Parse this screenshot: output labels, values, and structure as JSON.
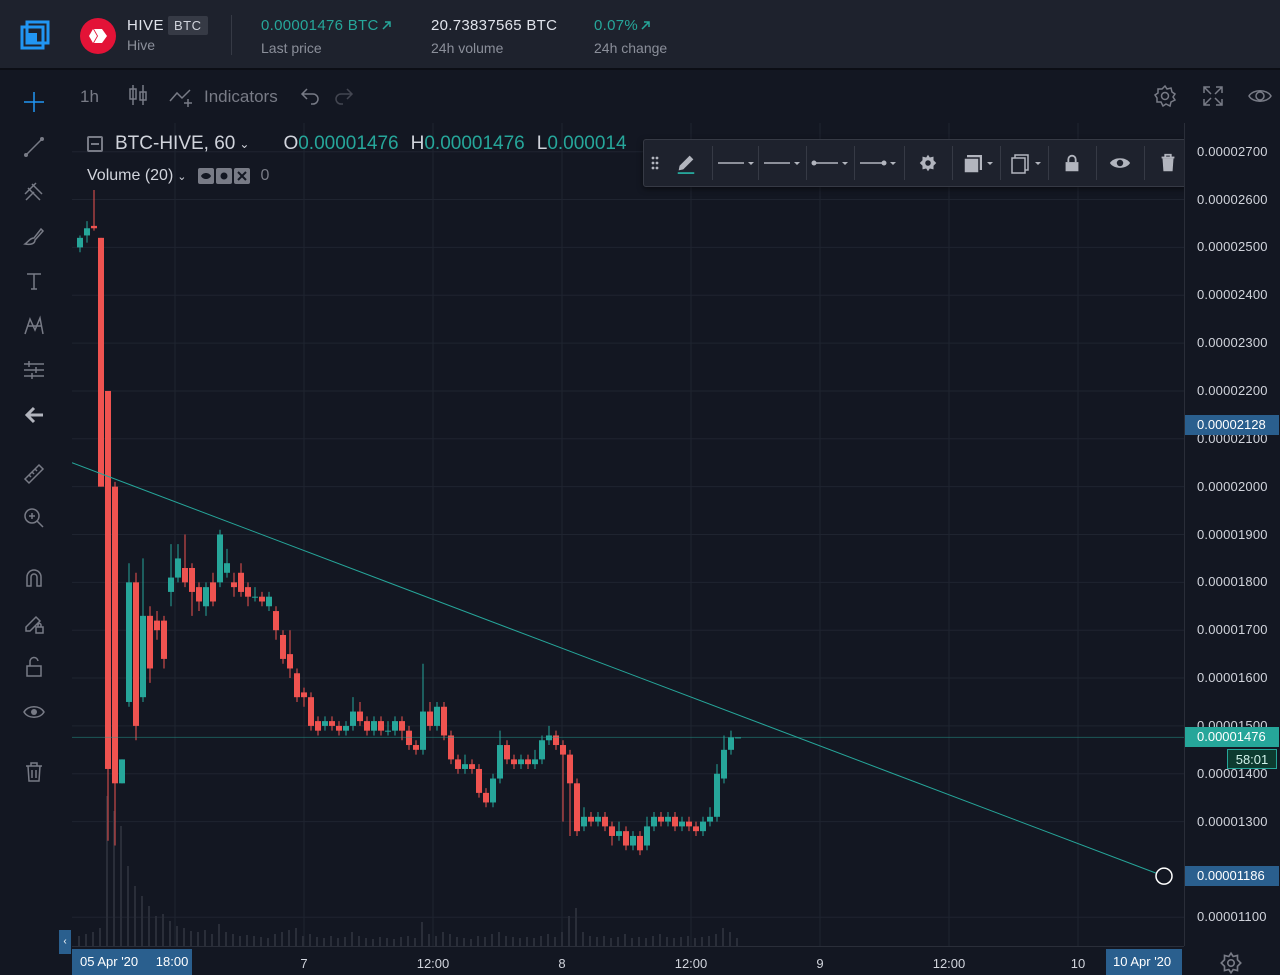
{
  "market": {
    "base": "HIVE",
    "quote": "BTC",
    "name": "Hive",
    "last_price": "0.00001476 BTC",
    "last_price_label": "Last price",
    "volume": "20.73837565 BTC",
    "volume_label": "24h volume",
    "change": "0.07%",
    "change_label": "24h change"
  },
  "toolbar": {
    "interval": "1h",
    "indicators_label": "Indicators"
  },
  "legend": {
    "symbol": "BTC-HIVE, 60",
    "open_key": "O",
    "open": "0.00001476",
    "high_key": "H",
    "high": "0.00001476",
    "low_key": "L",
    "low": "0.000014"
  },
  "volume_study": {
    "label": "Volume (20)",
    "value": "0"
  },
  "price_axis": {
    "ticks": [
      "0.00002700",
      "0.00002600",
      "0.00002500",
      "0.00002400",
      "0.00002300",
      "0.00002200",
      "0.00002100",
      "0.00002000",
      "0.00001900",
      "0.00001800",
      "0.00001700",
      "0.00001600",
      "0.00001500",
      "0.00001400",
      "0.00001300",
      "0.00001100"
    ],
    "marker_top": "0.00002128",
    "marker_current": "0.00001476",
    "countdown": "58:01",
    "marker_bottom": "0.00001186"
  },
  "time_axis": {
    "range_start": "05 Apr '20",
    "range_start_time": "18:00",
    "range_end": "10 Apr '20",
    "labels": [
      "7",
      "12:00",
      "8",
      "12:00",
      "9",
      "12:00",
      "10"
    ]
  },
  "colors": {
    "background": "#131722",
    "panel": "#1e222d",
    "up": "#26a69a",
    "down": "#ef5350",
    "trendline": "#26a69a",
    "accent_blue": "#2a5f8e",
    "hive_red": "#e31337"
  },
  "icons": {
    "left_toolbar": [
      "crosshair-icon",
      "trend-line-icon",
      "pitchfork-icon",
      "brush-icon",
      "text-icon",
      "pattern-icon",
      "forecast-icon",
      "back-arrow-icon",
      "ruler-icon",
      "zoom-in-icon",
      "magnet-icon",
      "lock-drawing-icon",
      "unlock-icon",
      "eye-icon",
      "trash-icon"
    ],
    "floating_toolbar": [
      "drag-handle-icon",
      "pencil-icon",
      "line-color-icon",
      "line-width-icon",
      "line-start-icon",
      "line-end-icon",
      "gear-icon",
      "fill-icon",
      "clone-icon",
      "lock-icon",
      "eye-icon",
      "trash-icon"
    ]
  },
  "chart_data": {
    "type": "candlestick",
    "interval": "60m",
    "ylim": [
      1.04e-05,
      2.76e-05
    ],
    "x_labels": [
      "7",
      "12:00",
      "8",
      "12:00",
      "9",
      "12:00",
      "10"
    ],
    "candles_ohlc": [
      [
        2.5e-05,
        2.52e-05,
        2.49e-05,
        2.525e-05
      ],
      [
        2.525e-05,
        2.54e-05,
        2.51e-05,
        2.555e-05
      ],
      [
        2.545e-05,
        2.54e-05,
        2.62e-05,
        2.535e-05
      ],
      [
        2.52e-05,
        2e-05,
        2.52e-05,
        2e-05
      ],
      [
        2.2e-05,
        1.41e-05,
        2.2e-05,
        1.26e-05
      ],
      [
        2e-05,
        1.38e-05,
        2.01e-05,
        1.25e-05
      ],
      [
        1.38e-05,
        1.43e-05,
        1.38e-05,
        1.42e-05
      ],
      [
        1.55e-05,
        1.8e-05,
        1.54e-05,
        1.84e-05
      ],
      [
        1.8e-05,
        1.5e-05,
        1.82e-05,
        1.47e-05
      ],
      [
        1.56e-05,
        1.73e-05,
        1.55e-05,
        1.85e-05
      ],
      [
        1.73e-05,
        1.62e-05,
        1.75e-05,
        1.59e-05
      ],
      [
        1.72e-05,
        1.7e-05,
        1.74e-05,
        1.68e-05
      ],
      [
        1.72e-05,
        1.64e-05,
        1.73e-05,
        1.62e-05
      ],
      [
        1.78e-05,
        1.81e-05,
        1.75e-05,
        1.88e-05
      ],
      [
        1.81e-05,
        1.85e-05,
        1.8e-05,
        1.88e-05
      ],
      [
        1.83e-05,
        1.8e-05,
        1.9e-05,
        1.79e-05
      ],
      [
        1.83e-05,
        1.78e-05,
        1.84e-05,
        1.73e-05
      ],
      [
        1.79e-05,
        1.76e-05,
        1.8e-05,
        1.74e-05
      ],
      [
        1.75e-05,
        1.79e-05,
        1.73e-05,
        1.8e-05
      ],
      [
        1.8e-05,
        1.76e-05,
        1.82e-05,
        1.75e-05
      ],
      [
        1.8e-05,
        1.9e-05,
        1.79e-05,
        1.91e-05
      ],
      [
        1.82e-05,
        1.84e-05,
        1.81e-05,
        1.87e-05
      ],
      [
        1.8e-05,
        1.79e-05,
        1.82e-05,
        1.77e-05
      ],
      [
        1.82e-05,
        1.78e-05,
        1.84e-05,
        1.77e-05
      ],
      [
        1.79e-05,
        1.77e-05,
        1.8e-05,
        1.75e-05
      ],
      [
        1.77e-05,
        1.77e-05,
        1.79e-05,
        1.76e-05
      ],
      [
        1.77e-05,
        1.76e-05,
        1.78e-05,
        1.75e-05
      ],
      [
        1.75e-05,
        1.77e-05,
        1.74e-05,
        1.78e-05
      ],
      [
        1.74e-05,
        1.7e-05,
        1.75e-05,
        1.68e-05
      ],
      [
        1.69e-05,
        1.64e-05,
        1.7e-05,
        1.63e-05
      ],
      [
        1.65e-05,
        1.62e-05,
        1.7e-05,
        1.6e-05
      ],
      [
        1.61e-05,
        1.56e-05,
        1.62e-05,
        1.55e-05
      ],
      [
        1.57e-05,
        1.56e-05,
        1.58e-05,
        1.54e-05
      ],
      [
        1.56e-05,
        1.5e-05,
        1.57e-05,
        1.49e-05
      ],
      [
        1.51e-05,
        1.49e-05,
        1.52e-05,
        1.48e-05
      ],
      [
        1.5e-05,
        1.51e-05,
        1.49e-05,
        1.52e-05
      ],
      [
        1.51e-05,
        1.5e-05,
        1.52e-05,
        1.49e-05
      ],
      [
        1.5e-05,
        1.49e-05,
        1.51e-05,
        1.48e-05
      ],
      [
        1.49e-05,
        1.5e-05,
        1.48e-05,
        1.51e-05
      ],
      [
        1.5e-05,
        1.53e-05,
        1.49e-05,
        1.56e-05
      ],
      [
        1.53e-05,
        1.51e-05,
        1.55e-05,
        1.5e-05
      ],
      [
        1.51e-05,
        1.49e-05,
        1.52e-05,
        1.48e-05
      ],
      [
        1.49e-05,
        1.51e-05,
        1.48e-05,
        1.52e-05
      ],
      [
        1.51e-05,
        1.49e-05,
        1.52e-05,
        1.48e-05
      ],
      [
        1.49e-05,
        1.49e-05,
        1.51e-05,
        1.48e-05
      ],
      [
        1.49e-05,
        1.51e-05,
        1.48e-05,
        1.52e-05
      ],
      [
        1.51e-05,
        1.49e-05,
        1.52e-05,
        1.47e-05
      ],
      [
        1.49e-05,
        1.46e-05,
        1.5e-05,
        1.45e-05
      ],
      [
        1.46e-05,
        1.45e-05,
        1.47e-05,
        1.44e-05
      ],
      [
        1.45e-05,
        1.53e-05,
        1.44e-05,
        1.63e-05
      ],
      [
        1.53e-05,
        1.5e-05,
        1.55e-05,
        1.49e-05
      ],
      [
        1.5e-05,
        1.54e-05,
        1.49e-05,
        1.55e-05
      ],
      [
        1.54e-05,
        1.48e-05,
        1.55e-05,
        1.47e-05
      ],
      [
        1.48e-05,
        1.43e-05,
        1.49e-05,
        1.42e-05
      ],
      [
        1.43e-05,
        1.41e-05,
        1.44e-05,
        1.4e-05
      ],
      [
        1.41e-05,
        1.42e-05,
        1.4e-05,
        1.44e-05
      ],
      [
        1.42e-05,
        1.41e-05,
        1.43e-05,
        1.4e-05
      ],
      [
        1.41e-05,
        1.36e-05,
        1.42e-05,
        1.35e-05
      ],
      [
        1.36e-05,
        1.34e-05,
        1.37e-05,
        1.33e-05
      ],
      [
        1.34e-05,
        1.39e-05,
        1.33e-05,
        1.4e-05
      ],
      [
        1.39e-05,
        1.46e-05,
        1.38e-05,
        1.49e-05
      ],
      [
        1.46e-05,
        1.43e-05,
        1.47e-05,
        1.42e-05
      ],
      [
        1.43e-05,
        1.42e-05,
        1.44e-05,
        1.41e-05
      ],
      [
        1.42e-05,
        1.43e-05,
        1.41e-05,
        1.44e-05
      ],
      [
        1.43e-05,
        1.42e-05,
        1.44e-05,
        1.41e-05
      ],
      [
        1.42e-05,
        1.43e-05,
        1.41e-05,
        1.45e-05
      ],
      [
        1.43e-05,
        1.47e-05,
        1.42e-05,
        1.48e-05
      ],
      [
        1.47e-05,
        1.48e-05,
        1.46e-05,
        1.5e-05
      ],
      [
        1.48e-05,
        1.46e-05,
        1.49e-05,
        1.45e-05
      ],
      [
        1.46e-05,
        1.44e-05,
        1.47e-05,
        1.3e-05
      ],
      [
        1.44e-05,
        1.38e-05,
        1.45e-05,
        1.27e-05
      ],
      [
        1.38e-05,
        1.28e-05,
        1.39e-05,
        1.27e-05
      ],
      [
        1.29e-05,
        1.31e-05,
        1.28e-05,
        1.33e-05
      ],
      [
        1.31e-05,
        1.3e-05,
        1.32e-05,
        1.29e-05
      ],
      [
        1.3e-05,
        1.31e-05,
        1.29e-05,
        1.32e-05
      ],
      [
        1.31e-05,
        1.29e-05,
        1.32e-05,
        1.28e-05
      ],
      [
        1.29e-05,
        1.27e-05,
        1.3e-05,
        1.25e-05
      ],
      [
        1.27e-05,
        1.28e-05,
        1.26e-05,
        1.3e-05
      ],
      [
        1.28e-05,
        1.25e-05,
        1.29e-05,
        1.24e-05
      ],
      [
        1.25e-05,
        1.27e-05,
        1.24e-05,
        1.28e-05
      ],
      [
        1.27e-05,
        1.24e-05,
        1.28e-05,
        1.23e-05
      ],
      [
        1.25e-05,
        1.29e-05,
        1.24e-05,
        1.31e-05
      ],
      [
        1.29e-05,
        1.31e-05,
        1.28e-05,
        1.32e-05
      ],
      [
        1.31e-05,
        1.3e-05,
        1.32e-05,
        1.29e-05
      ],
      [
        1.3e-05,
        1.31e-05,
        1.29e-05,
        1.32e-05
      ],
      [
        1.31e-05,
        1.29e-05,
        1.32e-05,
        1.28e-05
      ],
      [
        1.29e-05,
        1.3e-05,
        1.28e-05,
        1.31e-05
      ],
      [
        1.3e-05,
        1.29e-05,
        1.31e-05,
        1.28e-05
      ],
      [
        1.29e-05,
        1.28e-05,
        1.3e-05,
        1.27e-05
      ],
      [
        1.28e-05,
        1.3e-05,
        1.27e-05,
        1.31e-05
      ],
      [
        1.3e-05,
        1.31e-05,
        1.29e-05,
        1.33e-05
      ],
      [
        1.31e-05,
        1.4e-05,
        1.3e-05,
        1.42e-05
      ],
      [
        1.39e-05,
        1.45e-05,
        1.38e-05,
        1.48e-05
      ],
      [
        1.45e-05,
        1.476e-05,
        1.44e-05,
        1.49e-05
      ],
      [
        1.476e-05,
        1.476e-05,
        1.476e-05,
        1.476e-05
      ]
    ],
    "ohlc_order": "open, close, high-or-low pairs as drawn",
    "trendline": {
      "start_price": 2.05e-05,
      "end_price": 1.186e-05
    },
    "current_price": 1.476e-05,
    "volume_axis_hidden": true
  }
}
